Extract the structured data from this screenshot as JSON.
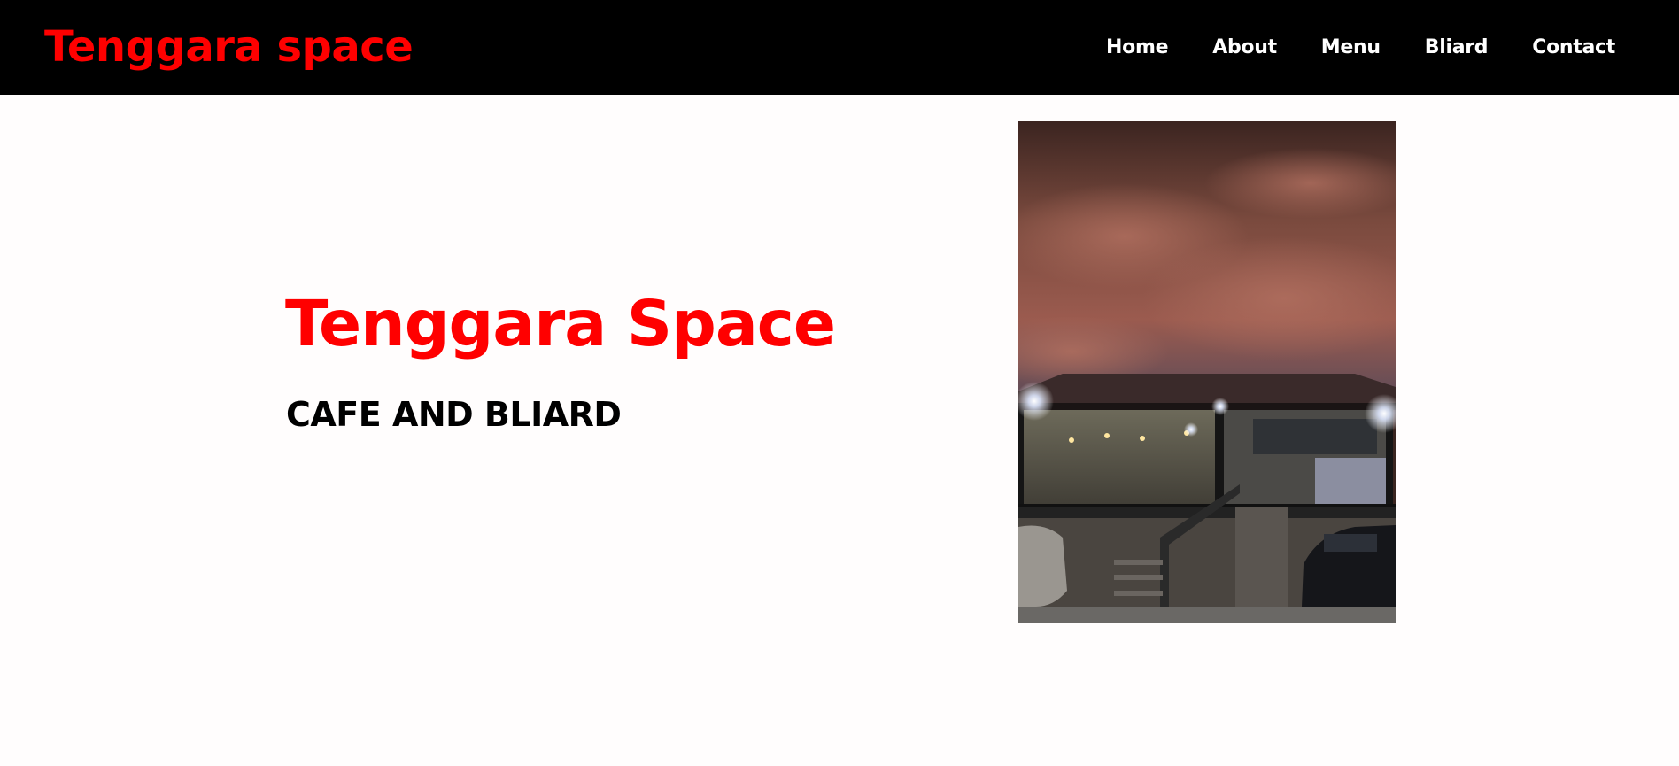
{
  "navbar": {
    "brand": "Tenggara space",
    "links": [
      {
        "label": "Home"
      },
      {
        "label": "About"
      },
      {
        "label": "Menu"
      },
      {
        "label": "Bliard"
      },
      {
        "label": "Contact"
      }
    ]
  },
  "hero": {
    "title": "Tenggara Space",
    "subtitle": "CAFE AND BLIARD",
    "image_alt": "cafe-building-at-dusk-photo"
  },
  "colors": {
    "accent": "#ff0000",
    "navbar_bg": "#000000",
    "nav_text": "#ffffff",
    "page_bg": "#fffdfd"
  }
}
